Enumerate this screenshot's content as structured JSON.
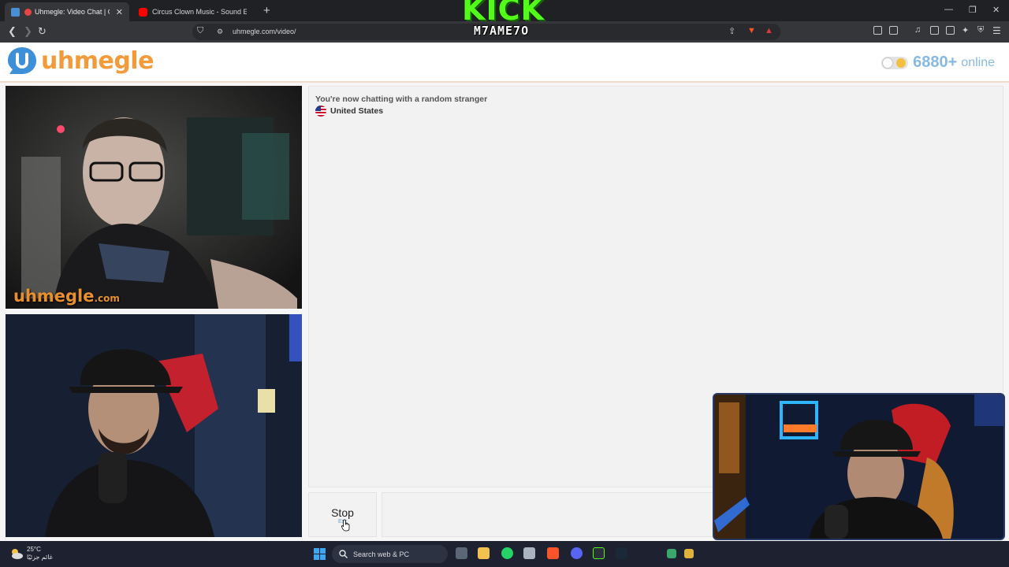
{
  "browser": {
    "tabs": [
      {
        "title": "Uhmegle: Video Chat | Omeg",
        "active": true
      },
      {
        "title": "Circus Clown Music - Sound Effect (",
        "active": false
      }
    ],
    "url": "uhmegle.com/video/"
  },
  "overlay": {
    "brand": "KICK",
    "channel": "M7AME7O"
  },
  "site": {
    "logo_text": "uhmegle",
    "online_count": "6880+",
    "online_label": "online"
  },
  "video": {
    "watermark": "uhmegle",
    "watermark_suffix": ".com"
  },
  "chat": {
    "status": "You're now chatting with a random stranger",
    "country": "United States",
    "stop_label": "Stop",
    "stop_hint": "Esc"
  },
  "taskbar": {
    "temperature": "25°C",
    "weather_note": "غائم جزئيًا",
    "search_placeholder": "Search web & PC"
  },
  "colors": {
    "accent_orange": "#f39b3a",
    "accent_blue": "#86b9e3",
    "kick_green": "#53fc18"
  }
}
